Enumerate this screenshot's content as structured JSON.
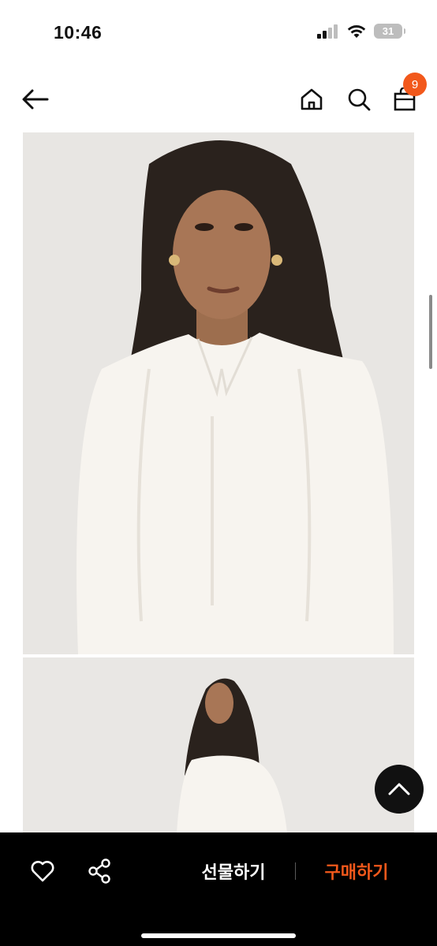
{
  "status_bar": {
    "time": "10:46",
    "battery": "31"
  },
  "header": {
    "cart_count": "9"
  },
  "product_images": [
    {
      "alt": "product-photo-closeup"
    },
    {
      "alt": "product-photo-full"
    }
  ],
  "bottom_bar": {
    "gift_label": "선물하기",
    "buy_label": "구매하기"
  },
  "colors": {
    "accent": "#f2581b",
    "bar_bg": "#000000",
    "photo_bg": "#e9e7e4"
  },
  "icons": [
    "back-arrow-icon",
    "home-icon",
    "search-icon",
    "shopping-bag-icon",
    "chevron-up-icon",
    "heart-icon",
    "share-icon"
  ]
}
